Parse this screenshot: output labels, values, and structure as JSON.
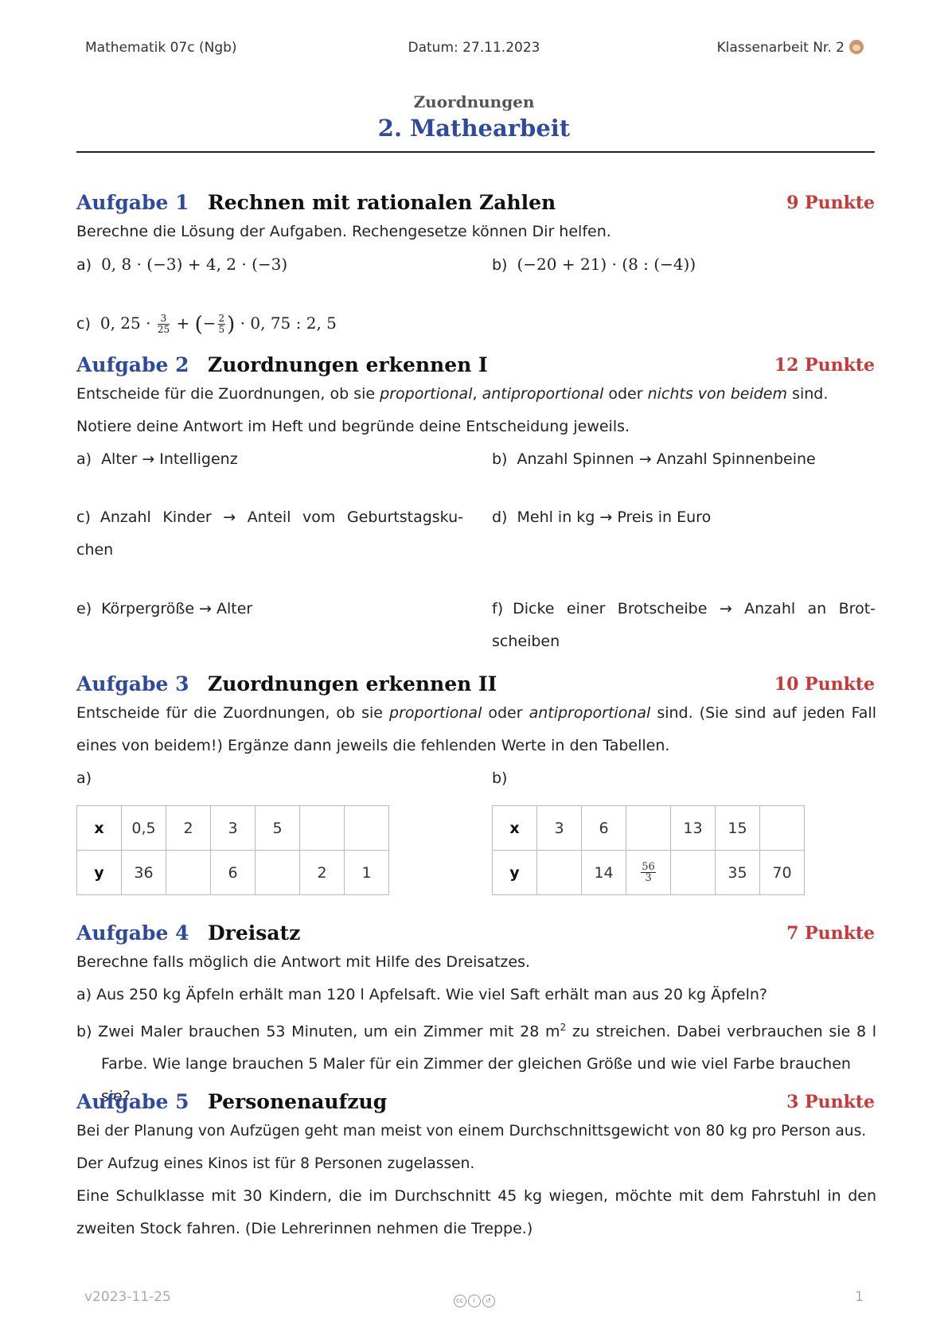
{
  "header": {
    "course": "Mathematik 07c (Ngb)",
    "date": "Datum: 27.11.2023",
    "exam": "Klassenarbeit Nr. 2"
  },
  "subtitle": "Zuordnungen",
  "title": "2. Mathearbeit",
  "tasks": [
    {
      "number": "Aufgabe 1",
      "title": "Rechnen mit rationalen Zahlen",
      "points": "9 Punkte",
      "intro": "Berechne die Lösung der Aufgaben. Rechengesetze können Dir helfen.",
      "items": [
        {
          "label": "a)",
          "expr": "0, 8 · (−3) + 4, 2 · (−3)"
        },
        {
          "label": "b)",
          "expr": "(−20 + 21) · (8 : (−4))"
        },
        {
          "label": "c)",
          "expr_pre": "0, 25 ·",
          "frac1_num": "3",
          "frac1_den": "25",
          "expr_mid": "+",
          "frac2_sign": "−",
          "frac2_num": "2",
          "frac2_den": "5",
          "expr_post": "· 0, 75 : 2, 5"
        }
      ]
    },
    {
      "number": "Aufgabe 2",
      "title": "Zuordnungen erkennen I",
      "points": "12 Punkte",
      "intro_1": "Entscheide für die Zuordnungen, ob sie ",
      "intro_em1": "proportional",
      "intro_2": ", ",
      "intro_em2": "antiproportional",
      "intro_3": " oder ",
      "intro_em3": "nichts von beidem",
      "intro_4": " sind. Notiere deine Antwort im Heft und begründe deine Entscheidung jeweils.",
      "items": [
        {
          "label": "a)",
          "text": "Alter → Intelligenz"
        },
        {
          "label": "b)",
          "text": "Anzahl Spinnen → Anzahl Spinnenbeine"
        },
        {
          "label": "c)",
          "text": "Anzahl Kinder → Anteil vom Geburtstagsku-",
          "text2": "chen"
        },
        {
          "label": "d)",
          "text": "Mehl in kg → Preis in Euro"
        },
        {
          "label": "e)",
          "text": "Körpergröße → Alter"
        },
        {
          "label": "f)",
          "text": "Dicke einer Brotscheibe → Anzahl an Brot-",
          "text2": "scheiben"
        }
      ]
    },
    {
      "number": "Aufgabe 3",
      "title": "Zuordnungen erkennen II",
      "points": "10 Punkte",
      "intro_1": "Entscheide für die Zuordnungen, ob sie ",
      "intro_em1": "proportional",
      "intro_2": " oder ",
      "intro_em2": "antiproportional",
      "intro_3": " sind. (Sie sind auf jeden Fall eines von beidem!) Ergänze dann jeweils die fehlenden Werte in den Tabellen.",
      "table_a": {
        "label": "a)",
        "x_head": "x",
        "y_head": "y",
        "x": [
          "0,5",
          "2",
          "3",
          "5",
          "",
          ""
        ],
        "y": [
          "36",
          "",
          "6",
          "",
          "2",
          "1"
        ]
      },
      "table_b": {
        "label": "b)",
        "x_head": "x",
        "y_head": "y",
        "x": [
          "3",
          "6",
          "",
          "13",
          "15",
          ""
        ],
        "y": [
          "",
          "14",
          "",
          "",
          "35",
          "70"
        ],
        "frac_num": "56",
        "frac_den": "3"
      }
    },
    {
      "number": "Aufgabe 4",
      "title": "Dreisatz",
      "points": "7 Punkte",
      "intro": "Berechne falls möglich die Antwort mit Hilfe des Dreisatzes.",
      "items": [
        {
          "label": "a)",
          "text": "Aus 250 kg Äpfeln erhält man 120 l Apfelsaft. Wie viel Saft erhält man aus 20 kg Äpfeln?"
        },
        {
          "label": "b)",
          "text_pre": "Zwei Maler brauchen 53 Minuten, um ein Zimmer mit 28 m",
          "sup": "2",
          "text_post": " zu streichen. Dabei verbrauchen sie 8 l",
          "text2": "Farbe. Wie lange brauchen 5 Maler für ein Zimmer der gleichen Größe und wie viel Farbe brauchen sie?"
        }
      ]
    },
    {
      "number": "Aufgabe 5",
      "title": "Personenaufzug",
      "points": "3 Punkte",
      "p1": "Bei der Planung von Aufzügen geht man meist von einem Durchschnittsgewicht von 80 kg pro Person aus. Der Aufzug eines Kinos ist für 8 Personen zugelassen.",
      "p2": "Eine Schulklasse mit 30 Kindern, die im Durchschnitt 45 kg wiegen, möchte mit dem Fahrstuhl in den zweiten Stock fahren. (Die Lehrerinnen nehmen die Treppe.)"
    }
  ],
  "footer": {
    "version": "v2023-11-25",
    "page": "1",
    "license_icon": "cc-by-sa-icon"
  }
}
